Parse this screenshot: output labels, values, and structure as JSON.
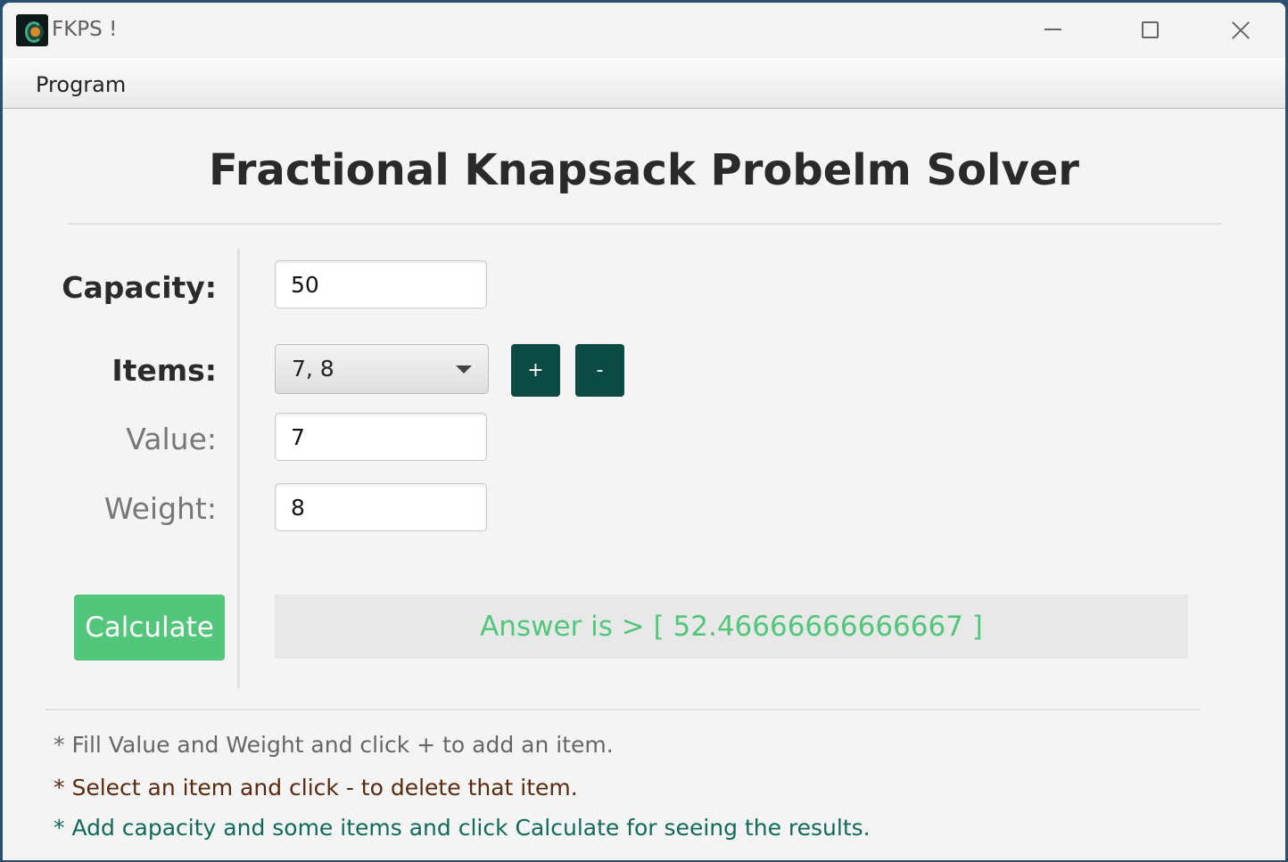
{
  "window": {
    "title": "FKPS !"
  },
  "menu": {
    "items": [
      "Program"
    ]
  },
  "main": {
    "heading": "Fractional Knapsack Probelm Solver",
    "capacity_label": "Capacity:",
    "capacity_value": "50",
    "items_label": "Items:",
    "items_selected": "7, 8",
    "add_label": "+",
    "delete_label": "-",
    "value_label": "Value:",
    "value_value": "7",
    "weight_label": "Weight:",
    "weight_value": "8",
    "calculate_label": "Calculate",
    "answer": "Answer is > [ 52.46666666666667 ]"
  },
  "hints": [
    "* Fill Value and Weight and click + to add an item.",
    "* Select an item and click - to delete that item.",
    "* Add capacity and some items and click Calculate for seeing the results."
  ],
  "colors": {
    "accent_green": "#52c77b",
    "dark_teal": "#0c4a44",
    "hint_brown": "#5a2a0e",
    "hint_teal": "#0f6a5a"
  },
  "icons": {
    "app": "app-logo-icon",
    "minimize": "minimize-icon",
    "maximize": "maximize-icon",
    "close": "close-icon",
    "dropdown": "chevron-down-icon"
  }
}
